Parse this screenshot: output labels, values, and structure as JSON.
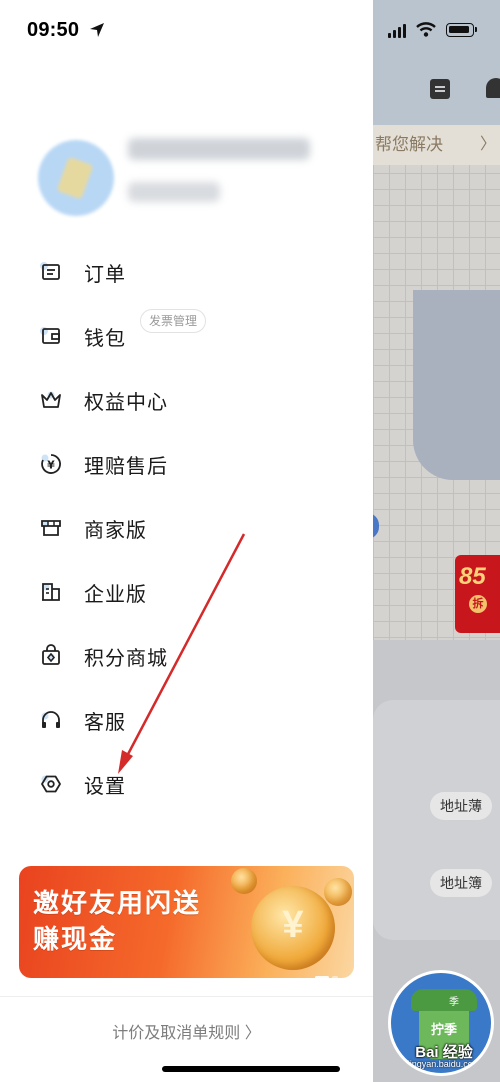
{
  "status_bar": {
    "time": "09:50"
  },
  "drawer": {
    "menu": [
      {
        "label": "订单",
        "icon": "order-list-icon"
      },
      {
        "label": "钱包",
        "icon": "wallet-icon",
        "tag": "发票管理"
      },
      {
        "label": "权益中心",
        "icon": "crown-icon"
      },
      {
        "label": "理赔售后",
        "icon": "yuan-refund-icon"
      },
      {
        "label": "商家版",
        "icon": "store-icon"
      },
      {
        "label": "企业版",
        "icon": "building-icon"
      },
      {
        "label": "积分商城",
        "icon": "points-bag-icon"
      },
      {
        "label": "客服",
        "icon": "headset-icon"
      },
      {
        "label": "设置",
        "icon": "hexagon-settings-icon"
      }
    ],
    "banner": {
      "line1": "邀好友用闪送",
      "line2": "赚现金",
      "coin_symbol": "¥"
    },
    "footer_link": "计价及取消单规则 〉"
  },
  "background": {
    "help_text": "帮您解决",
    "help_chevron": "〉",
    "address_button_1": "地址薄",
    "address_button_2": "地址簿",
    "promo_text": "85",
    "promo_tag": "拆"
  },
  "watermark": {
    "cup_text": "拧季",
    "cup_small": "季",
    "text": "Bai 经验",
    "url": "jingyan.baidu.com"
  },
  "colors": {
    "accent_red": "#e9431f",
    "arrow": "#d42a2a",
    "text_primary": "#1a1a1a",
    "text_secondary": "#7d7d7d"
  }
}
